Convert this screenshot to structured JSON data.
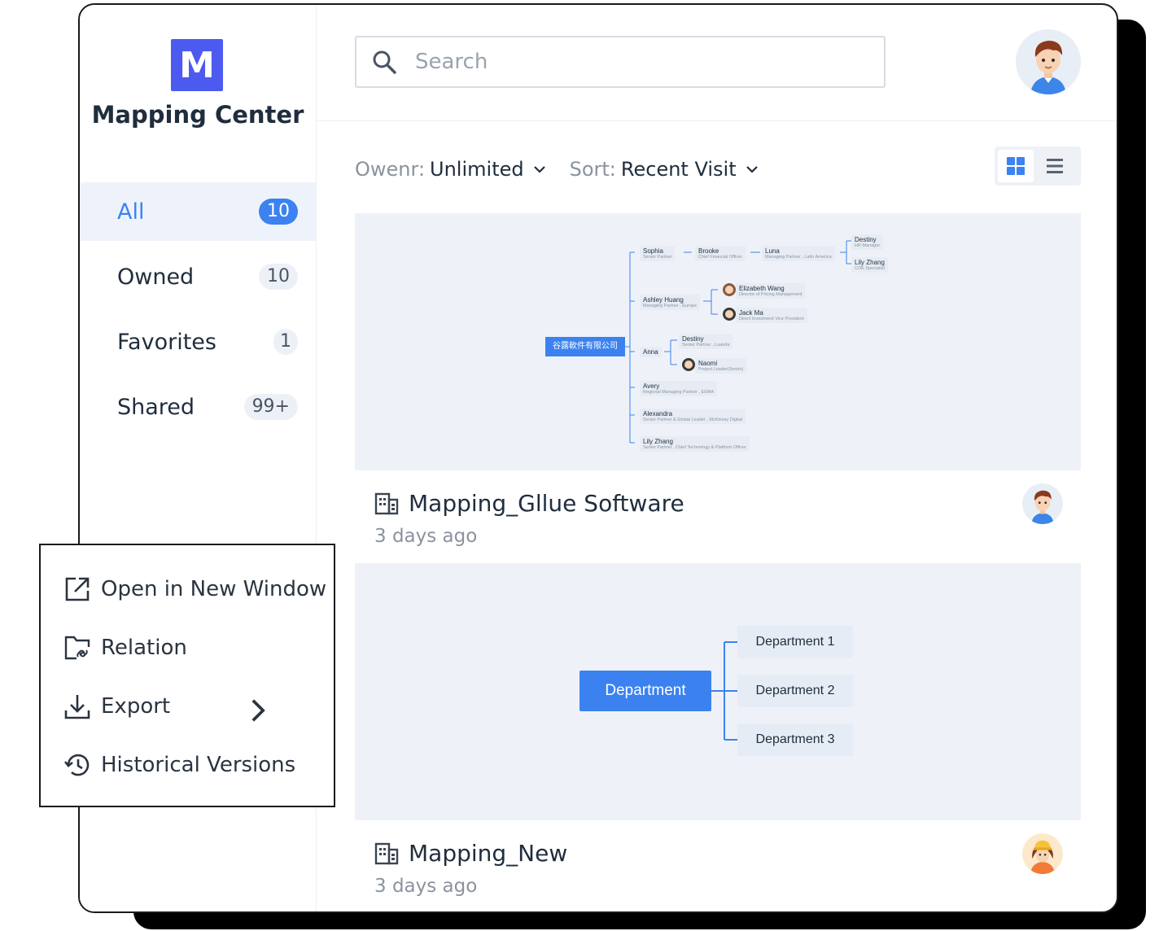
{
  "app": {
    "logo_letter": "M",
    "title": "Mapping Center"
  },
  "nav": [
    {
      "label": "All",
      "count": "10"
    },
    {
      "label": "Owned",
      "count": "10"
    },
    {
      "label": "Favorites",
      "count": "1"
    },
    {
      "label": "Shared",
      "count": "99+"
    }
  ],
  "search": {
    "placeholder": "Search"
  },
  "filters": {
    "owner_key": "Owenr:",
    "owner_value": "Unlimited",
    "sort_key": "Sort:",
    "sort_value": "Recent Visit"
  },
  "cards": [
    {
      "title": "Mapping_Gllue Software",
      "time": "3 days ago",
      "root": "谷露軟件有限公司",
      "nodes": [
        {
          "name": "Sophia",
          "role": "Senior Partner"
        },
        {
          "name": "Brooke",
          "role": "Chief Financial Officer"
        },
        {
          "name": "Luna",
          "role": "Managing Partner , Latin America"
        },
        {
          "name": "Destiny",
          "role": "HR Manager"
        },
        {
          "name": "Lily Zhang",
          "role": "COE Specialist"
        },
        {
          "name": "Ashley Huang",
          "role": "Managing Partner , Europe"
        },
        {
          "name": "Elizabeth Wang",
          "role": "Director of Pricing Management"
        },
        {
          "name": "Jack Ma",
          "role": "Direct Investment Vice President"
        },
        {
          "name": "Anna",
          "role": ""
        },
        {
          "name": "Destiny",
          "role": "Senior Partner , Luanda"
        },
        {
          "name": "Naomi",
          "role": "Project Leader(Senior)"
        },
        {
          "name": "Avery",
          "role": "Regional Managing Partner , EEMA"
        },
        {
          "name": "Alexandra",
          "role": "Senior Partner & Global Leader , McKinsey Digital"
        },
        {
          "name": "Lily Zhang",
          "role": "Senior Partner , Chief Technology & Platform Officer"
        }
      ]
    },
    {
      "title": "Mapping_New",
      "time": "3 days ago",
      "root": "Department",
      "nodes": [
        "Department 1",
        "Department 2",
        "Department 3"
      ]
    }
  ],
  "context_menu": [
    {
      "label": "Open in New Window",
      "icon": "open-external-icon"
    },
    {
      "label": "Relation",
      "icon": "folder-link-icon"
    },
    {
      "label": "Export",
      "icon": "download-icon"
    },
    {
      "label": "Historical Versions",
      "icon": "history-icon"
    }
  ],
  "colors": {
    "accent": "#3c82f0",
    "logo": "#4d5af0",
    "preview_bg": "#eef2f8"
  }
}
